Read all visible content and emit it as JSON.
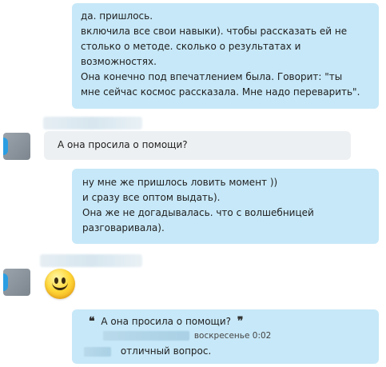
{
  "messages": {
    "out1": {
      "lines": [
        "да. пришлось.",
        "включила все свои навыки). чтобы рассказать ей не",
        "столько о методе. сколько о результатах и",
        "возможностях.",
        "Она конечно под впечатлением была. Говорит: \"ты",
        "мне сейчас космос рассказала. Мне надо переварить\"."
      ]
    },
    "in1": {
      "text": "А она просила о помощи?"
    },
    "out2": {
      "lines": [
        "ну мне же пришлось ловить момент ))",
        "и сразу все оптом выдать).",
        "Она же не догадывалась. что с волшебницей",
        "разговаривала)."
      ]
    },
    "in2": {
      "emoticon": "smile-emoticon"
    },
    "out3": {
      "quote_open": "❝",
      "quote_text": "А она просила о помощи?",
      "quote_close": "❞",
      "quote_timestamp": "воскресенье 0:02",
      "reply_text": "отличный вопрос."
    }
  },
  "colors": {
    "outgoing_bubble": "#c7e8f8",
    "incoming_bubble": "#edf0f2",
    "status_online": "#2a9ee3"
  }
}
